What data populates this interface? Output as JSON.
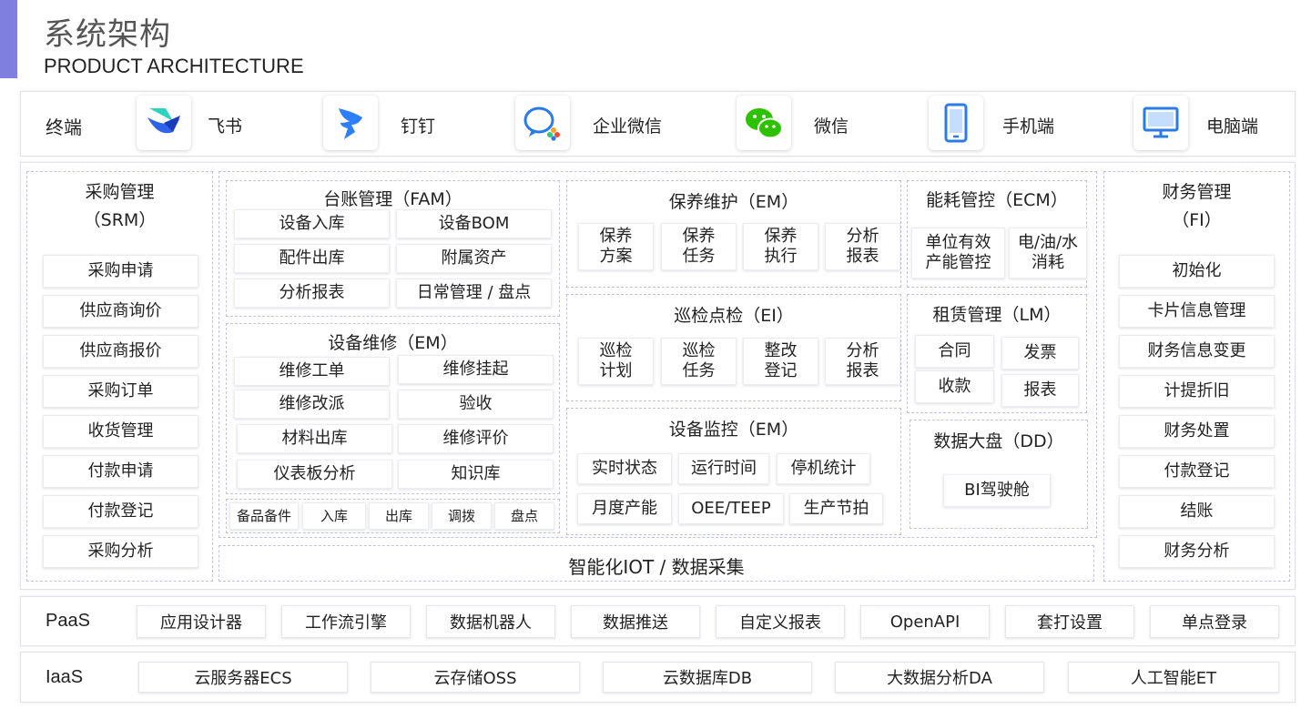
{
  "header": {
    "title_cn": "系统架构",
    "title_en": "PRODUCT ARCHITECTURE"
  },
  "terminal": {
    "label": "终端",
    "items": [
      {
        "label": "飞书",
        "icon": "feishu-icon"
      },
      {
        "label": "钉钉",
        "icon": "dingtalk-icon"
      },
      {
        "label": "企业微信",
        "icon": "wecom-icon"
      },
      {
        "label": "微信",
        "icon": "wechat-icon"
      },
      {
        "label": "手机端",
        "icon": "mobile-icon"
      },
      {
        "label": "电脑端",
        "icon": "desktop-icon"
      }
    ]
  },
  "srm": {
    "title": "采购管理",
    "subtitle": "（SRM）",
    "items": [
      "采购申请",
      "供应商询价",
      "供应商报价",
      "采购订单",
      "收货管理",
      "付款申请",
      "付款登记",
      "采购分析"
    ]
  },
  "fam": {
    "title": "台账管理（FAM）",
    "items": [
      "设备入库",
      "设备BOM",
      "配件出库",
      "附属资产",
      "分析报表",
      "日常管理 / 盘点"
    ]
  },
  "em_repair": {
    "title": "设备维修（EM）",
    "items": [
      "维修工单",
      "维修挂起",
      "维修改派",
      "验收",
      "材料出库",
      "维修评价",
      "仪表板分析",
      "知识库"
    ]
  },
  "spare": {
    "items": [
      "备品备件",
      "入库",
      "出库",
      "调拨",
      "盘点"
    ]
  },
  "em_maint": {
    "title": "保养维护（EM）",
    "items": [
      "保养\n方案",
      "保养\n任务",
      "保养\n执行",
      "分析\n报表"
    ]
  },
  "ei": {
    "title": "巡检点检（EI）",
    "items": [
      "巡检\n计划",
      "巡检\n任务",
      "整改\n登记",
      "分析\n报表"
    ]
  },
  "em_monitor": {
    "title": "设备监控（EM）",
    "items": [
      "实时状态",
      "运行时间",
      "停机统计",
      "月度产能",
      "OEE/TEEP",
      "生产节拍"
    ]
  },
  "ecm": {
    "title": "能耗管控（ECM）",
    "items": [
      "单位有效\n产能管控",
      "电/油/水\n消耗"
    ]
  },
  "lm": {
    "title": "租赁管理（LM）",
    "items": [
      "合同",
      "发票",
      "收款",
      "报表"
    ]
  },
  "dd": {
    "title": "数据大盘（DD）",
    "items": [
      "BI驾驶舱"
    ]
  },
  "iot": {
    "label": "智能化IOT / 数据采集"
  },
  "fi": {
    "title": "财务管理",
    "subtitle": "（FI）",
    "items": [
      "初始化",
      "卡片信息管理",
      "财务信息变更",
      "计提折旧",
      "财务处置",
      "付款登记",
      "结账",
      "财务分析"
    ]
  },
  "paas": {
    "label": "PaaS",
    "items": [
      "应用设计器",
      "工作流引擎",
      "数据机器人",
      "数据推送",
      "自定义报表",
      "OpenAPI",
      "套打设置",
      "单点登录"
    ]
  },
  "iaas": {
    "label": "IaaS",
    "items": [
      "云服务器ECS",
      "云存储OSS",
      "云数据库DB",
      "大数据分析DA",
      "人工智能ET"
    ]
  },
  "colors": {
    "accent": "#7f7fe0",
    "dash": "#c2c2e8"
  }
}
